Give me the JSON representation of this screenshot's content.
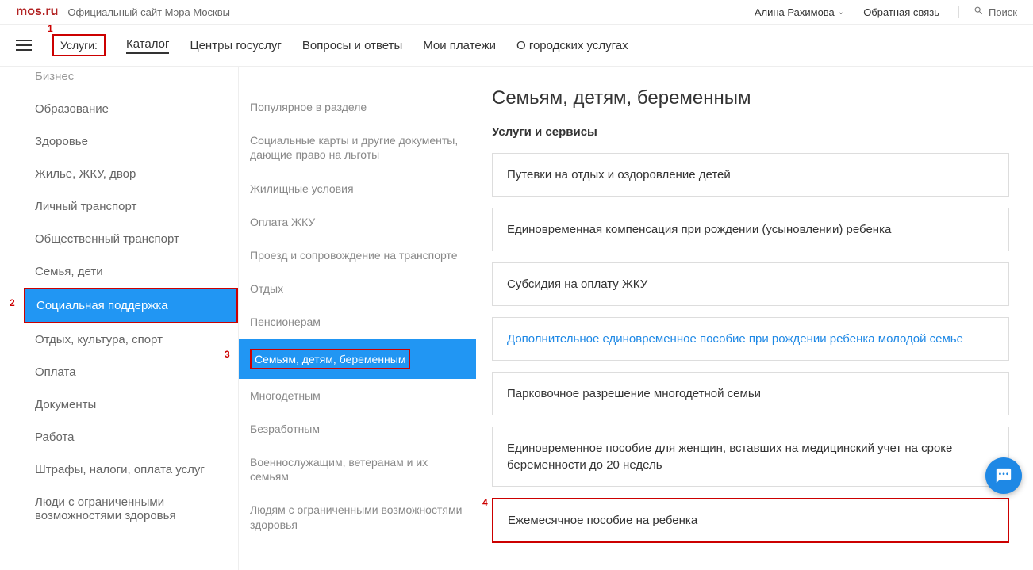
{
  "topbar": {
    "logo": "mos.ru",
    "tagline": "Официальный сайт Мэра Москвы",
    "user": "Алина Рахимова",
    "feedback": "Обратная связь",
    "search": "Поиск"
  },
  "nav": {
    "items": [
      "Услуги:",
      "Каталог",
      "Центры госуслуг",
      "Вопросы и ответы",
      "Мои платежи",
      "О городских услугах"
    ]
  },
  "annotations": {
    "a1": "1",
    "a2": "2",
    "a3": "3",
    "a4": "4"
  },
  "col1": {
    "items": [
      "Бизнес",
      "Образование",
      "Здоровье",
      "Жилье, ЖКУ, двор",
      "Личный транспорт",
      "Общественный транспорт",
      "Семья, дети",
      "Социальная поддержка",
      "Отдых, культура, спорт",
      "Оплата",
      "Документы",
      "Работа",
      "Штрафы, налоги, оплата услуг",
      "Люди с ограниченными возможностями здоровья"
    ],
    "selected_index": 7
  },
  "col2": {
    "items": [
      "Популярное в разделе",
      "Социальные карты и другие документы, дающие право на льготы",
      "Жилищные условия",
      "Оплата ЖКУ",
      "Проезд и сопровождение на транспорте",
      "Отдых",
      "Пенсионерам",
      "Семьям, детям, беременным",
      "Многодетным",
      "Безработным",
      "Военнослужащим, ветеранам и их семьям",
      "Людям с ограниченными возможностями здоровья"
    ],
    "selected_index": 7
  },
  "col3": {
    "title": "Семьям, детям, беременным",
    "section": "Услуги и сервисы",
    "services": [
      {
        "label": "Путевки на отдых и оздоровление детей",
        "link": false,
        "boxed": false
      },
      {
        "label": "Единовременная компенсация при рождении (усыновлении) ребенка",
        "link": false,
        "boxed": false
      },
      {
        "label": "Субсидия на оплату ЖКУ",
        "link": false,
        "boxed": false
      },
      {
        "label": "Дополнительное единовременное пособие при рождении ребенка молодой семье",
        "link": true,
        "boxed": false
      },
      {
        "label": "Парковочное разрешение многодетной семьи",
        "link": false,
        "boxed": false
      },
      {
        "label": "Единовременное пособие для женщин, вставших на медицинский учет на сроке беременности до 20 недель",
        "link": false,
        "boxed": false
      },
      {
        "label": "Ежемесячное пособие на ребенка",
        "link": false,
        "boxed": true
      }
    ]
  }
}
